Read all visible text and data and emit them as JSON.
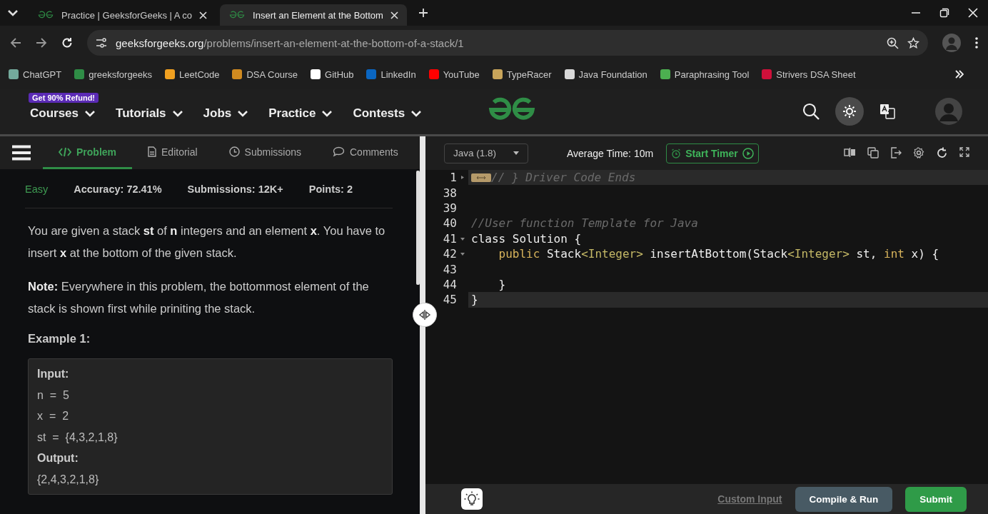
{
  "browser": {
    "tabs": [
      {
        "title": "Practice | GeeksforGeeks | A co",
        "selected": false
      },
      {
        "title": "Insert an Element at the Bottom",
        "selected": true
      }
    ],
    "url": {
      "domain": "geeksforgeeks.org",
      "path": "/problems/insert-an-element-at-the-bottom-of-a-stack/1"
    },
    "bookmarks": [
      {
        "label": "ChatGPT",
        "color": "#74aa9c"
      },
      {
        "label": "greeksforgeeks",
        "color": "#2f8d46"
      },
      {
        "label": "LeetCode",
        "color": "#f0a020"
      },
      {
        "label": "DSA Course",
        "color": "#d08a20"
      },
      {
        "label": "GitHub",
        "color": "#ffffff"
      },
      {
        "label": "LinkedIn",
        "color": "#0a66c2"
      },
      {
        "label": "YouTube",
        "color": "#ff0000"
      },
      {
        "label": "TypeRacer",
        "color": "#c8a45a"
      },
      {
        "label": "Java Foundation",
        "color": "#d8d8d8"
      },
      {
        "label": "Paraphrasing Tool",
        "color": "#4caf50"
      },
      {
        "label": "Strivers DSA Sheet",
        "color": "#d0103a"
      }
    ]
  },
  "header": {
    "badge": "Get 90% Refund!",
    "nav": [
      "Courses",
      "Tutorials",
      "Jobs",
      "Practice",
      "Contests"
    ]
  },
  "problem": {
    "tabs": [
      {
        "label": "Problem",
        "kind": "code",
        "selected": true
      },
      {
        "label": "Editorial",
        "kind": "document",
        "selected": false
      },
      {
        "label": "Submissions",
        "kind": "clock",
        "selected": false
      },
      {
        "label": "Comments",
        "kind": "chat",
        "selected": false
      }
    ],
    "difficulty": "Easy",
    "accuracy": "Accuracy: 72.41%",
    "submissions": "Submissions: 12K+",
    "points": "Points: 2",
    "paragraphs": [
      "You are given a stack **st** of **n** integers and an element **x**. You have to insert **x** at the bottom of the given stack.",
      "**Note:** Everywhere in this problem, the bottommost element of the stack is shown first while priniting the stack."
    ],
    "example_title": "Example 1:",
    "example_lines": [
      {
        "kind": "label",
        "text": "Input:"
      },
      {
        "kind": "value",
        "text": "n  =  5"
      },
      {
        "kind": "value",
        "text": "x  =  2"
      },
      {
        "kind": "value",
        "text": "st  =  {4,3,2,1,8}"
      },
      {
        "kind": "label",
        "text": "Output:"
      },
      {
        "kind": "value",
        "text": "{2,4,3,2,1,8}"
      }
    ]
  },
  "editor": {
    "language": "Java (1.8)",
    "average_time": "Average Time: 10m",
    "timer": "Start Timer",
    "lines": [
      {
        "number": "1",
        "fold": true,
        "collapsed": true,
        "highlighted": true,
        "tokens": [
          {
            "kind": "faded",
            "text": "// } Driver Code Ends"
          }
        ]
      },
      {
        "number": "38",
        "fold": false,
        "collapsed": false,
        "highlighted": false
      },
      {
        "number": "39",
        "fold": false,
        "collapsed": false,
        "highlighted": false
      },
      {
        "number": "40",
        "fold": false,
        "collapsed": false,
        "highlighted": false,
        "tokens": [
          {
            "kind": "comment",
            "text": "//User function Template for Java"
          }
        ]
      },
      {
        "number": "41",
        "fold": true,
        "collapsed": false,
        "highlighted": false,
        "tokens": [
          {
            "kind": "plain",
            "text": "class Solution {"
          }
        ]
      },
      {
        "number": "42",
        "fold": true,
        "collapsed": false,
        "highlighted": false,
        "tokens": [
          {
            "kind": "keyword",
            "text": "    public"
          },
          {
            "kind": "plain",
            "text": " Stack"
          },
          {
            "kind": "type",
            "text": "<Integer>"
          },
          {
            "kind": "plain",
            "text": " insertAtBottom(Stack"
          },
          {
            "kind": "type",
            "text": "<Integer>"
          },
          {
            "kind": "plain",
            "text": " st, "
          },
          {
            "kind": "keyword",
            "text": "int"
          },
          {
            "kind": "plain",
            "text": " x) {"
          }
        ]
      },
      {
        "number": "43",
        "fold": false,
        "collapsed": false,
        "highlighted": false
      },
      {
        "number": "44",
        "fold": false,
        "collapsed": false,
        "highlighted": false,
        "tokens": [
          {
            "kind": "plain",
            "text": "    }"
          }
        ]
      },
      {
        "number": "45",
        "fold": false,
        "collapsed": false,
        "highlighted": true,
        "tokens": [
          {
            "kind": "plain",
            "text": "}"
          }
        ]
      }
    ],
    "custom_input": "Custom Input",
    "compile": "Compile & Run",
    "submit": "Submit"
  }
}
